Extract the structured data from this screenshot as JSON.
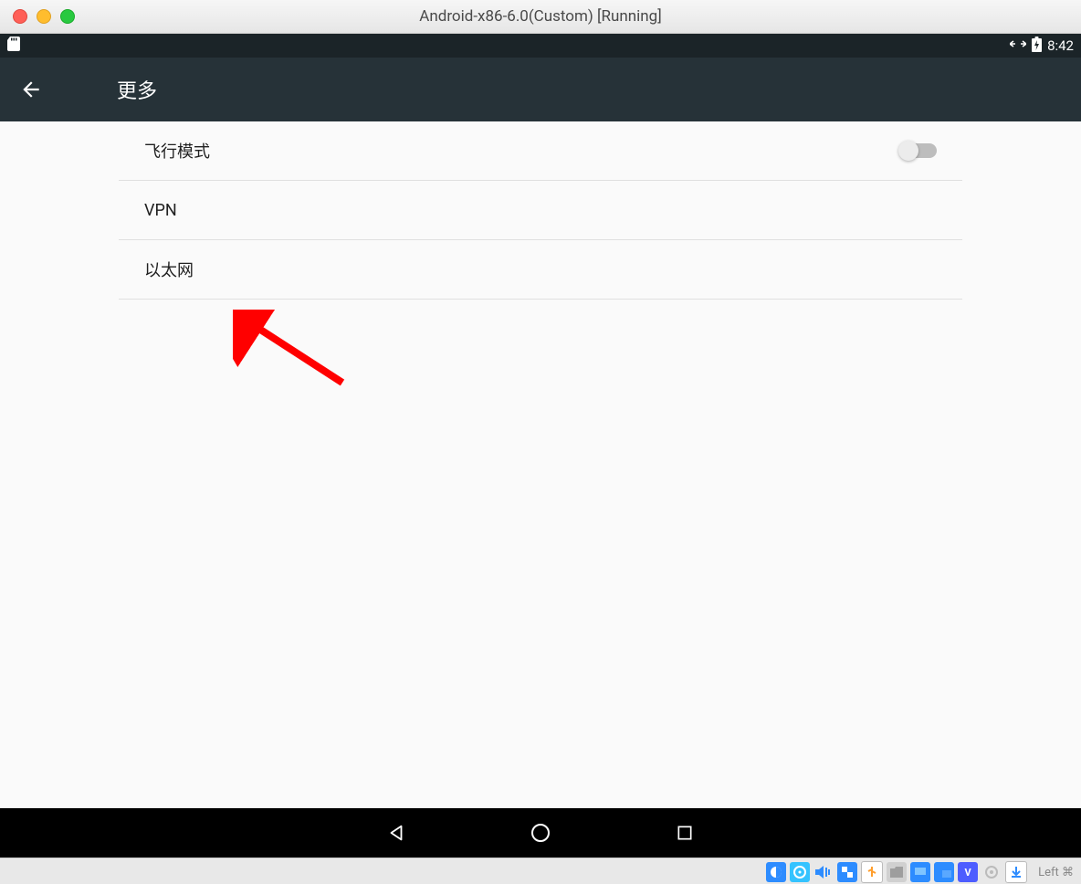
{
  "window": {
    "title": "Android-x86-6.0(Custom)   [Running]"
  },
  "statusbar": {
    "sd_icon": "sd-card",
    "network_icon": "↔",
    "battery_icon": "⚡",
    "time": "8:42"
  },
  "appbar": {
    "back_icon": "←",
    "title": "更多"
  },
  "settings": {
    "airplane_label": "飞行模式",
    "airplane_on": false,
    "vpn_label": "VPN",
    "ethernet_label": "以太网"
  },
  "navbar": {
    "back": "back",
    "home": "home",
    "recents": "recents"
  },
  "host_tray": {
    "status_text": "Left ⌘"
  }
}
